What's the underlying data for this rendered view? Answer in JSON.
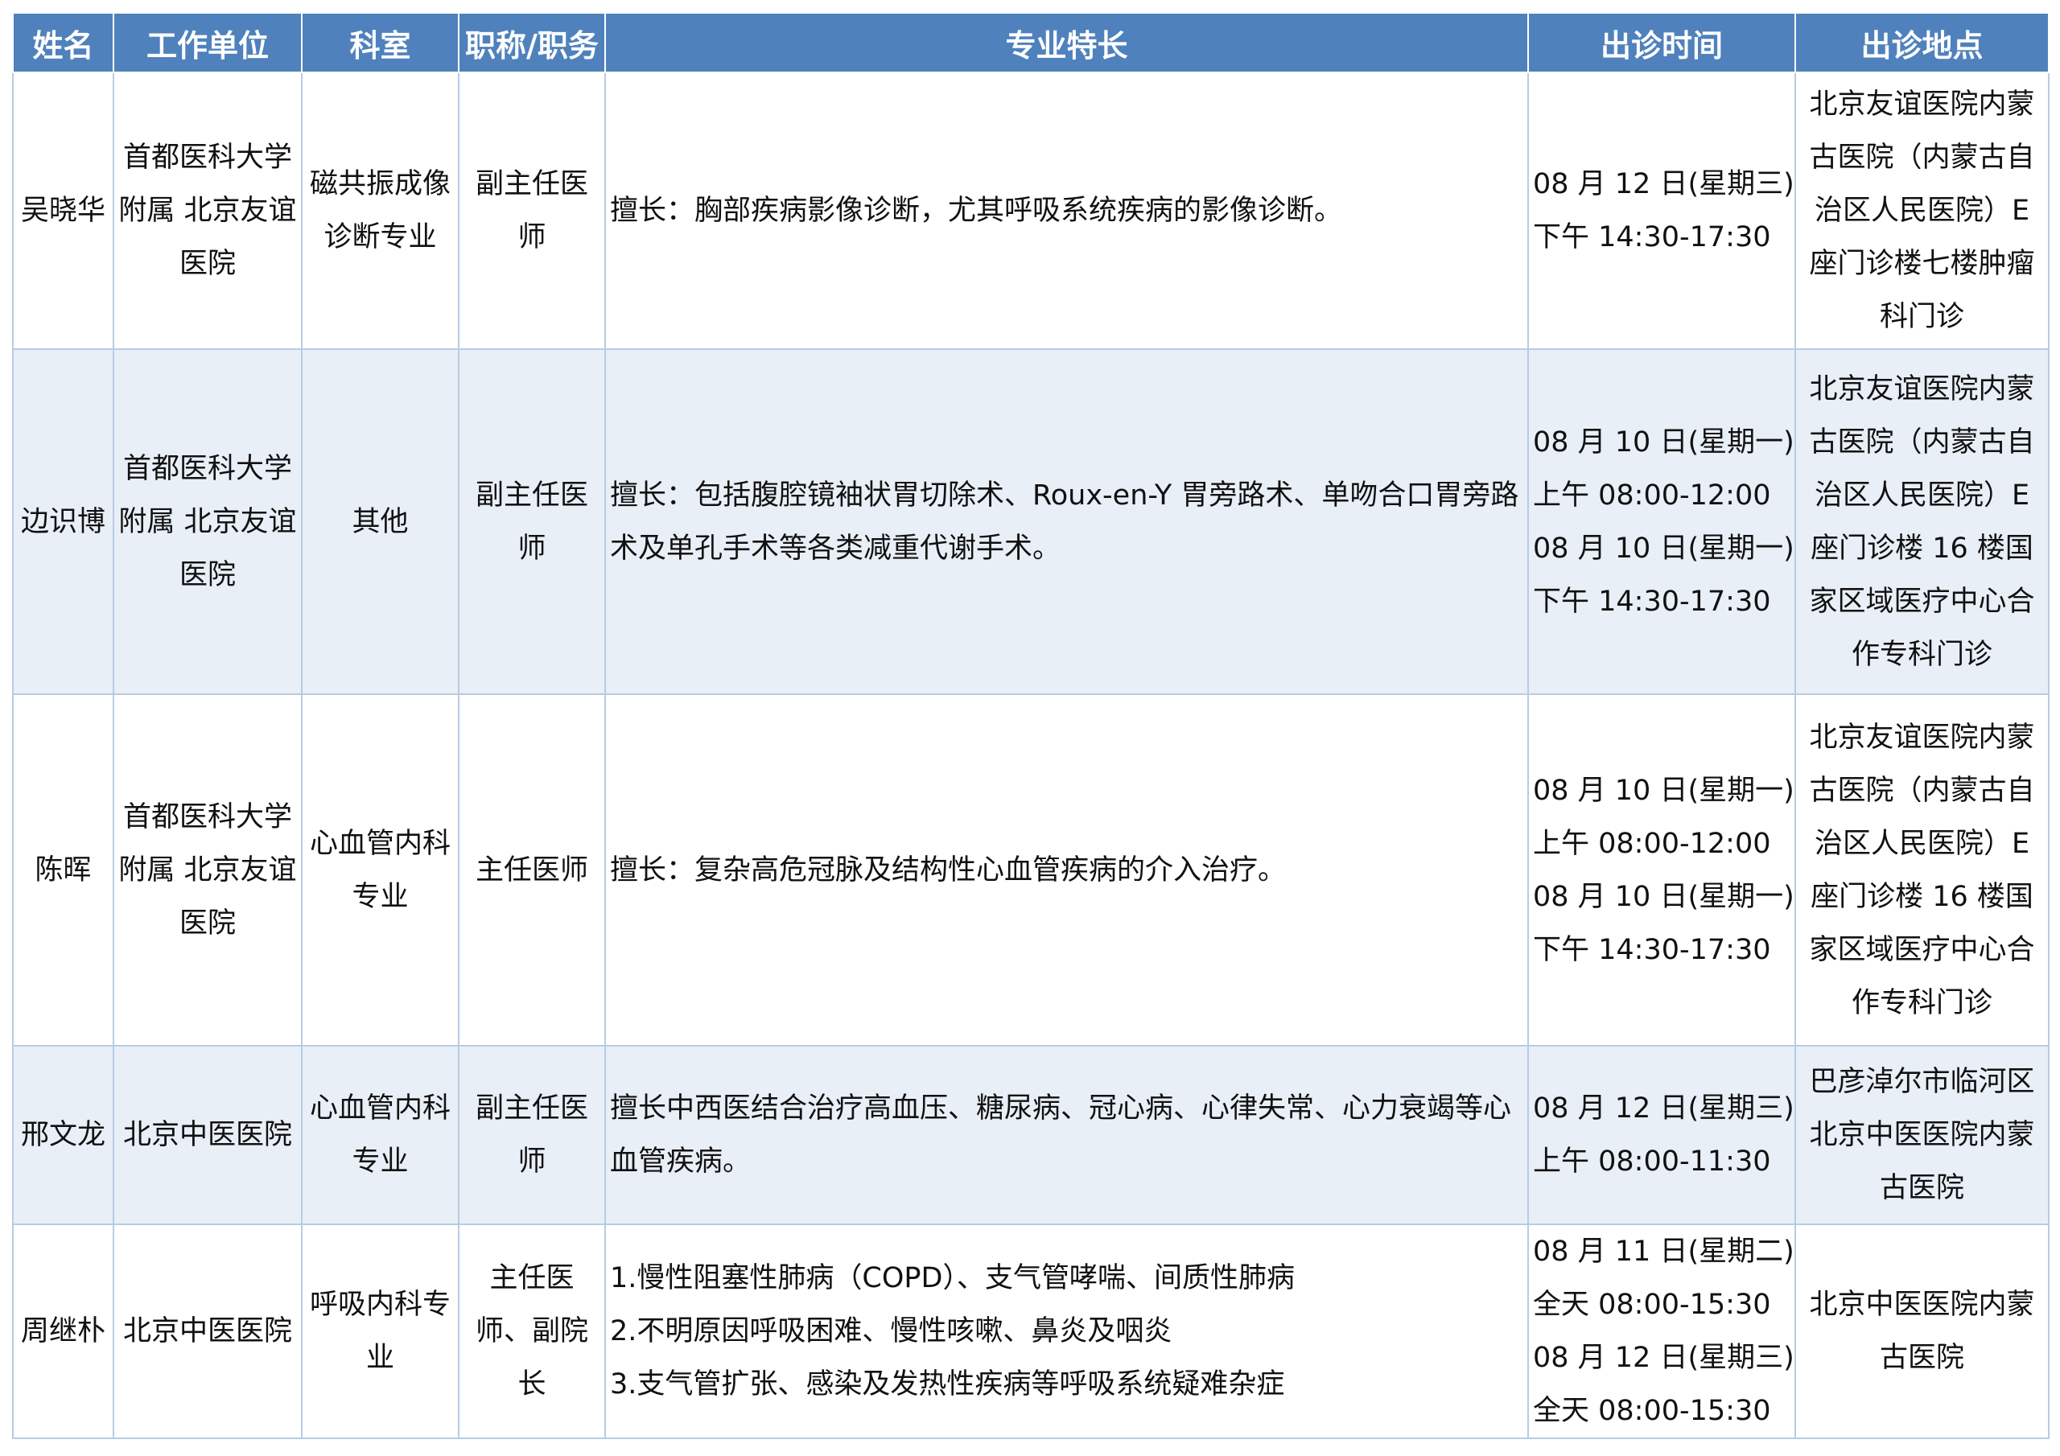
{
  "headers": {
    "name": "姓名",
    "unit": "工作单位",
    "dept": "科室",
    "title": "职称/职务",
    "specialty": "专业特长",
    "time": "出诊时间",
    "location": "出诊地点"
  },
  "rows": [
    {
      "name": "吴晓华",
      "unit": "首都医科大学附属 北京友谊医院",
      "dept": "磁共振成像诊断专业",
      "title": "副主任医师",
      "specialty": [
        "擅长：胸部疾病影像诊断，尤其呼吸系统疾病的影像诊断。"
      ],
      "time": [
        "08 月 12 日(星期三)",
        "下午 14:30-17:30"
      ],
      "location": "北京友谊医院内蒙古医院（内蒙古自治区人民医院）E 座门诊楼七楼肿瘤科门诊"
    },
    {
      "name": "边识博",
      "unit": "首都医科大学附属 北京友谊医院",
      "dept": "其他",
      "title": "副主任医师",
      "specialty": [
        "擅长：包括腹腔镜袖状胃切除术、Roux-en-Y 胃旁路术、单吻合口胃旁路术及单孔手术等各类减重代谢手术。"
      ],
      "time": [
        "08 月 10 日(星期一)",
        "上午 08:00-12:00",
        "08 月 10 日(星期一)",
        "下午 14:30-17:30"
      ],
      "location": "北京友谊医院内蒙古医院（内蒙古自治区人民医院）E 座门诊楼 16 楼国家区域医疗中心合作专科门诊"
    },
    {
      "name": "陈晖",
      "unit": "首都医科大学附属 北京友谊医院",
      "dept": "心血管内科专业",
      "title": "主任医师",
      "specialty": [
        "擅长：复杂高危冠脉及结构性心血管疾病的介入治疗。"
      ],
      "time": [
        "08 月 10 日(星期一)",
        "上午 08:00-12:00",
        "08 月 10 日(星期一)",
        "下午 14:30-17:30"
      ],
      "location": "北京友谊医院内蒙古医院（内蒙古自治区人民医院）E 座门诊楼 16 楼国家区域医疗中心合作专科门诊"
    },
    {
      "name": "邢文龙",
      "unit": "北京中医医院",
      "dept": "心血管内科专业",
      "title": "副主任医师",
      "specialty": [
        "擅长中西医结合治疗高血压、糖尿病、冠心病、心律失常、心力衰竭等心血管疾病。"
      ],
      "time": [
        "08 月 12 日(星期三)",
        "上午 08:00-11:30"
      ],
      "location": "巴彦淖尔市临河区北京中医医院内蒙古医院"
    },
    {
      "name": "周继朴",
      "unit": "北京中医医院",
      "dept": "呼吸内科专业",
      "title": "主任医师、副院长",
      "specialty": [
        "1.慢性阻塞性肺病（COPD）、支气管哮喘、间质性肺病",
        "2.不明原因呼吸困难、慢性咳嗽、鼻炎及咽炎",
        "3.支气管扩张、感染及发热性疾病等呼吸系统疑难杂症"
      ],
      "time": [
        "08 月 11 日(星期二)",
        "全天 08:00-15:30",
        "08 月 12 日(星期三)",
        "全天 08:00-15:30"
      ],
      "location": "北京中医医院内蒙古医院"
    }
  ]
}
